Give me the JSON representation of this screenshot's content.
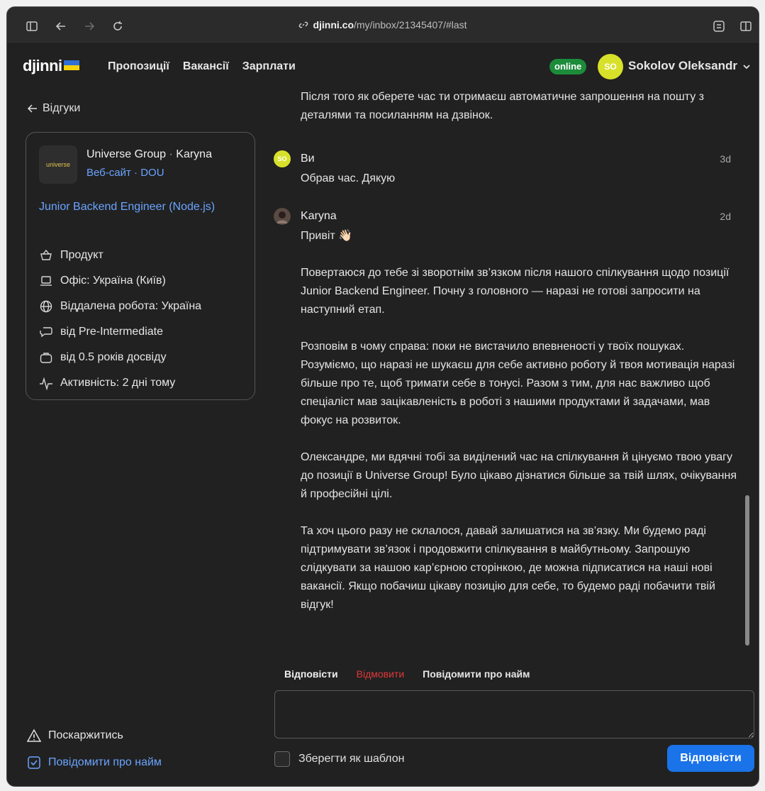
{
  "browser": {
    "url_host": "djinni.co",
    "url_path": "/my/inbox/21345407/#last"
  },
  "header": {
    "logo": "djinni",
    "nav": [
      "Пропозиції",
      "Вакансії",
      "Зарплати"
    ],
    "status": "online",
    "avatar_initials": "SO",
    "user_name": "Sokolov Oleksandr",
    "flag_colors": [
      "#2f6fd6",
      "#f5d20a"
    ]
  },
  "sidebar": {
    "back_label": "Відгуки",
    "company_logo_text": "universe",
    "company": "Universe Group",
    "recruiter": "Karyna",
    "link_site": "Веб-сайт",
    "link_dou": "DOU",
    "job_title": "Junior Backend Engineer (Node.js)",
    "attributes": [
      {
        "icon": "basket-icon",
        "text": "Продукт"
      },
      {
        "icon": "laptop-icon",
        "text": "Офіс: Україна (Київ)"
      },
      {
        "icon": "globe-icon",
        "text": "Віддалена робота: Україна"
      },
      {
        "icon": "chat-bubble-icon",
        "text": "від Pre-Intermediate"
      },
      {
        "icon": "briefcase-icon",
        "text": "від 0.5 років досвіду"
      },
      {
        "icon": "pulse-icon",
        "text": "Активність: 2 дні тому"
      }
    ],
    "complain": "Поскаржитись",
    "notify_hire": "Повідомити про найм"
  },
  "chat": {
    "prev_text": "Після того як оберете час ти отримаєш автоматичне запрошення на пошту з деталями та посиланням на дзвінок.",
    "messages": [
      {
        "author": "Ви",
        "avatar": "SO",
        "time": "3d",
        "paragraphs": [
          "Обрав час. Дякую"
        ]
      },
      {
        "author": "Karyna",
        "time": "2d",
        "paragraphs": [
          "Привіт 👋🏻",
          "Повертаюся до тебе зі зворотнім зв’язком після нашого спілкування щодо позиції Junior Backend Engineer. Почну з головного — наразі не готові запросити на наступний етап.",
          "Розповім в чому справа: поки не вистачило впевненості у твоїх пошуках. Розуміємо, що наразі не шукаєш для себе активно роботу й твоя мотивація наразі більше про те, щоб тримати себе в тонусі. Разом з тим, для нас важливо щоб спеціаліст мав зацікавленість в роботі з нашими продуктами й задачами, мав фокус на розвиток.",
          "Олександре, ми вдячні тобі за виділений час на спілкування й цінуємо твою увагу до позиції в Universe Group! Було цікаво дізнатися більше за твій шлях, очікування й професійні цілі.",
          "Та хоч цього разу не склалося, давай залишатися на зв’язку. Ми будемо раді підтримувати зв’язок і продовжити спілкування в майбутньому. Запрошую слідкувати за нашою кар’єрною сторінкою, де можна підписатися на наші нові вакансії. Якщо побачиш цікаву позицію для себе, то будемо раді побачити твій відгук!"
        ]
      }
    ]
  },
  "reply": {
    "tab_reply": "Відповісти",
    "tab_decline": "Відмовити",
    "tab_notify": "Повідомити про найм",
    "textarea_value": "",
    "save_template": "Зберегти як шаблон",
    "send": "Відповісти"
  },
  "colors": {
    "accent": "#1a73e8",
    "link": "#6aa4ff",
    "danger": "#e0383a",
    "online": "#1c8c3b",
    "avatar": "#d8e12a"
  }
}
